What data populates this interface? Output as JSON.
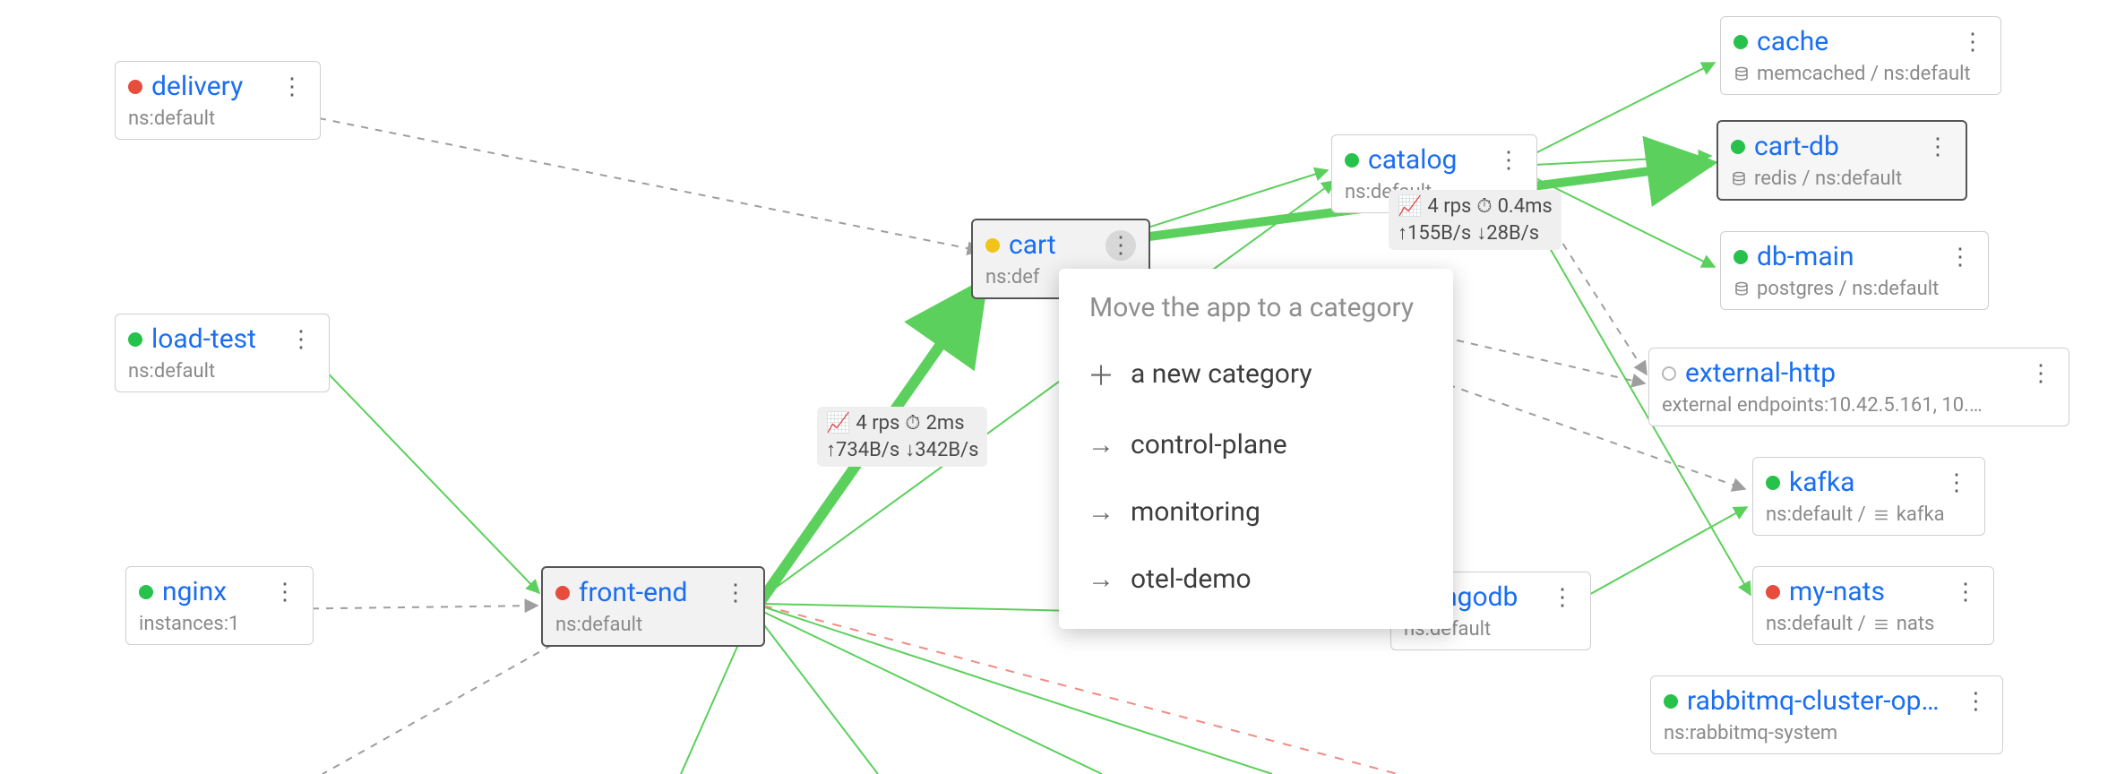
{
  "nodes": {
    "delivery": {
      "title": "delivery",
      "sub": "ns:default",
      "status": "red"
    },
    "load_test": {
      "title": "load-test",
      "sub": "ns:default",
      "status": "green"
    },
    "nginx": {
      "title": "nginx",
      "sub": "instances:1",
      "status": "green"
    },
    "front_end": {
      "title": "front-end",
      "sub": "ns:default",
      "status": "red"
    },
    "cart": {
      "title": "cart",
      "sub": "ns:def",
      "status": "yellow"
    },
    "catalog": {
      "title": "catalog",
      "sub": "ns:default",
      "status": "green"
    },
    "mongodb": {
      "title": "ongodb",
      "sub": "ns:default",
      "status": "green"
    },
    "cache": {
      "title": "cache",
      "sub_db": "memcached / ns:default",
      "status": "green"
    },
    "cart_db": {
      "title": "cart-db",
      "sub_db": "redis / ns:default",
      "status": "green"
    },
    "db_main": {
      "title": "db-main",
      "sub_db": "postgres / ns:default",
      "status": "green"
    },
    "external": {
      "title": "external-http",
      "sub": "external endpoints:10.42.5.161, 10.…",
      "status": "hollow"
    },
    "kafka": {
      "title": "kafka",
      "sub_stack": "ns:default / ",
      "stack_name": "kafka",
      "status": "green"
    },
    "my_nats": {
      "title": "my-nats",
      "sub_stack": "ns:default / ",
      "stack_name": "nats",
      "status": "red"
    },
    "rabbitmq": {
      "title": "rabbitmq-cluster-opera…",
      "sub": "ns:rabbitmq-system",
      "status": "green"
    }
  },
  "edge_labels": {
    "frontend_cart": {
      "rps": "4 rps",
      "lat": "2ms",
      "up": "↑734B/s",
      "down": "↓342B/s"
    },
    "cart_cartdb": {
      "rps": "4 rps",
      "lat": "0.4ms",
      "up": "↑155B/s",
      "down": "↓28B/s"
    }
  },
  "popup": {
    "title": "Move the app to a category",
    "items": [
      {
        "icon": "plus",
        "label": "a new category"
      },
      {
        "icon": "arrow",
        "label": "control-plane"
      },
      {
        "icon": "arrow",
        "label": "monitoring"
      },
      {
        "icon": "arrow",
        "label": "otel-demo"
      }
    ]
  },
  "colors": {
    "link_green": "#5cd05c",
    "link_red": "#f28b82",
    "link_gray": "#9e9e9e",
    "link_blue": "#1a6ef2"
  },
  "glyphs": {
    "chart": "📈",
    "clock": "⏱"
  }
}
